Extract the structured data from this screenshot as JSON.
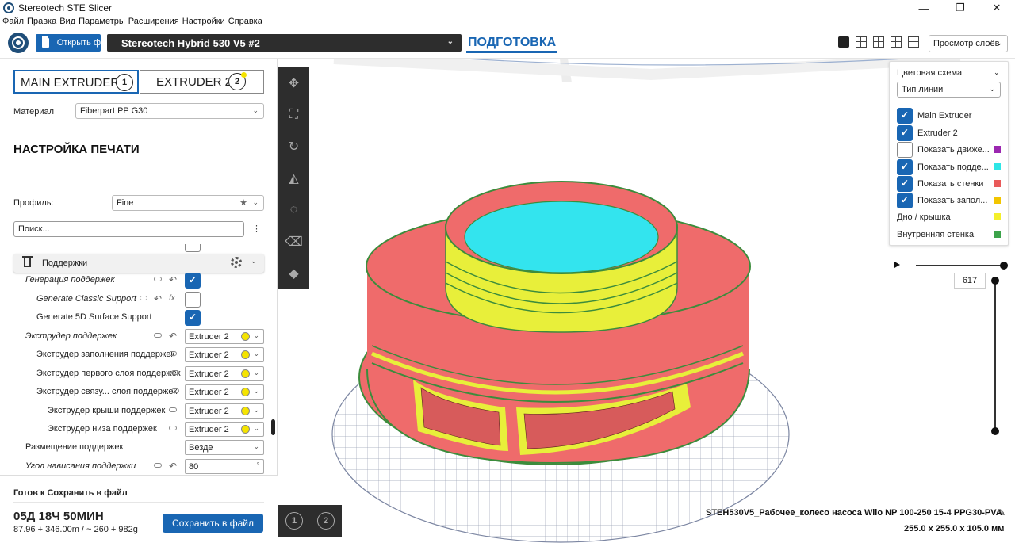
{
  "window": {
    "title": "Stereotech STE Slicer",
    "controls": [
      "—",
      "❐",
      "✕"
    ]
  },
  "menu": [
    "Файл",
    "Правка",
    "Вид",
    "Параметры",
    "Расширения",
    "Настройки",
    "Справка"
  ],
  "toolbar": {
    "open_label": "Открыть ф",
    "printer": "Stereotech Hybrid 530 V5 #2",
    "stage_tab": "ПОДГОТОВКА",
    "view_mode": "Просмотр слоёв"
  },
  "extruders": {
    "tabs": [
      {
        "label": "MAIN EXTRUDER",
        "num": "1"
      },
      {
        "label": "EXTRUDER 2",
        "num": "2"
      }
    ],
    "material_label": "Материал",
    "material_value": "Fiberpart PP G30"
  },
  "print_settings": {
    "title": "НАСТРОЙКА ПЕЧАТИ",
    "profile_label": "Профиль:",
    "profile_value": "Fine",
    "search_placeholder": "Поиск...",
    "category": "Поддержки",
    "rows": [
      {
        "label": "Генерация поддержек",
        "type": "check",
        "value": true
      },
      {
        "label": "Generate Classic Support",
        "type": "check",
        "value": false
      },
      {
        "label": "Generate 5D Surface Support",
        "type": "check",
        "value": true
      },
      {
        "label": "Экструдер поддержек",
        "type": "combo",
        "value": "Extruder 2"
      },
      {
        "label": "Экструдер заполнения поддержек",
        "type": "combo",
        "value": "Extruder 2"
      },
      {
        "label": "Экструдер первого слоя поддержек",
        "type": "combo",
        "value": "Extruder 2"
      },
      {
        "label": "Экструдер связу... слоя поддержек",
        "type": "combo",
        "value": "Extruder 2"
      },
      {
        "label": "Экструдер крыши поддержек",
        "type": "combo",
        "value": "Extruder 2"
      },
      {
        "label": "Экструдер низа поддержек",
        "type": "combo",
        "value": "Extruder 2"
      },
      {
        "label": "Размещение поддержек",
        "type": "combo",
        "value": "Везде"
      },
      {
        "label": "Угол нависания поддержки",
        "type": "number",
        "value": "80"
      }
    ]
  },
  "job": {
    "status": "Готов к Сохранить в файл",
    "time": "05Д 18Ч 50МИН",
    "material_usage": "87.96 + 346.00m / ~ 260 + 982g",
    "save_label": "Сохранить в файл"
  },
  "color_scheme": {
    "title": "Цветовая схема",
    "mode": "Тип линии",
    "items": [
      {
        "label": "Main Extruder",
        "checked": true,
        "color": ""
      },
      {
        "label": "Extruder 2",
        "checked": true,
        "color": ""
      },
      {
        "label": "Показать движе...",
        "checked": false,
        "color": "#9b27b0"
      },
      {
        "label": "Показать подде...",
        "checked": true,
        "color": "#2ee6e6"
      },
      {
        "label": "Показать стенки",
        "checked": true,
        "color": "#e95a5a"
      },
      {
        "label": "Показать запол...",
        "checked": true,
        "color": "#f2c500"
      },
      {
        "label": "Дно / крышка",
        "checked": null,
        "color": "#f4ef2b"
      },
      {
        "label": "Внутренняя стенка",
        "checked": null,
        "color": "#3ca34a"
      }
    ]
  },
  "layers": {
    "current": "617"
  },
  "model": {
    "file_name": "STEH530V5_Рабочее_колесо насоса Wilo NP 100-250 15-4 PPG30-PVA",
    "dimensions": "255.0 x 255.0 x 105.0 мм"
  },
  "colors": {
    "accent": "#1966b3",
    "walls": "#ef6b6b",
    "support": "#33e4ee",
    "skin": "#e8ef3a",
    "dark_panel": "#2d2d2d"
  }
}
